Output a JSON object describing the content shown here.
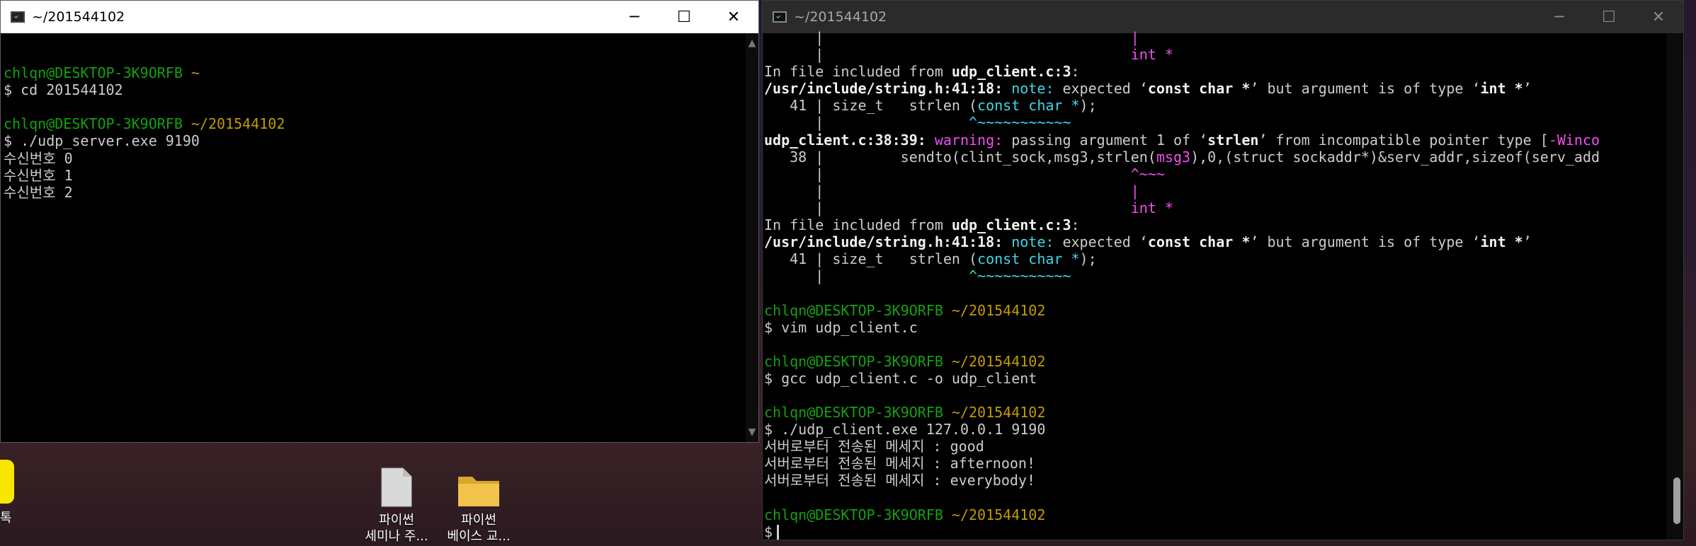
{
  "left_window": {
    "title": "~/201544102",
    "controls": {
      "minimize": "─",
      "maximize": "☐",
      "close": "✕"
    },
    "lines": [
      [
        {
          "t": "",
          "c": ""
        }
      ],
      [
        {
          "t": "chlqn@DESKTOP-3K9ORFB",
          "c": "green"
        },
        {
          "t": " ~",
          "c": "yellow"
        }
      ],
      [
        {
          "t": "$ cd 201544102",
          "c": ""
        }
      ],
      [
        {
          "t": "",
          "c": ""
        }
      ],
      [
        {
          "t": "chlqn@DESKTOP-3K9ORFB",
          "c": "green"
        },
        {
          "t": " ~/201544102",
          "c": "yellow"
        }
      ],
      [
        {
          "t": "$ ./udp_server.exe 9190",
          "c": ""
        }
      ],
      [
        {
          "t": "수신번호 0",
          "c": ""
        }
      ],
      [
        {
          "t": "수신번호 1",
          "c": ""
        }
      ],
      [
        {
          "t": "수신번호 2",
          "c": ""
        }
      ]
    ]
  },
  "right_window": {
    "title": "~/201544102",
    "controls": {
      "minimize": "─",
      "maximize": "☐",
      "close": "✕"
    },
    "lines": [
      [
        {
          "t": "      |                                    ",
          "c": ""
        },
        {
          "t": "|",
          "c": "magenta"
        }
      ],
      [
        {
          "t": "      |                                    ",
          "c": ""
        },
        {
          "t": "int *",
          "c": "magenta"
        }
      ],
      [
        {
          "t": "In file included from ",
          "c": ""
        },
        {
          "t": "udp_client.c:3",
          "c": "bold"
        },
        {
          "t": ":",
          "c": ""
        }
      ],
      [
        {
          "t": "/usr/include/string.h:41:18: ",
          "c": "bold"
        },
        {
          "t": "note: ",
          "c": "cyan"
        },
        {
          "t": "expected ‘",
          "c": ""
        },
        {
          "t": "const char *",
          "c": "bold"
        },
        {
          "t": "’ but argument is of type ‘",
          "c": ""
        },
        {
          "t": "int *",
          "c": "bold"
        },
        {
          "t": "’",
          "c": ""
        }
      ],
      [
        {
          "t": "   41 | size_t   strlen (",
          "c": ""
        },
        {
          "t": "const char *",
          "c": "cyan"
        },
        {
          "t": ");",
          "c": ""
        }
      ],
      [
        {
          "t": "      |                 ",
          "c": ""
        },
        {
          "t": "^~~~~~~~~~~~",
          "c": "cyan"
        }
      ],
      [
        {
          "t": "udp_client.c:38:39: ",
          "c": "bold"
        },
        {
          "t": "warning: ",
          "c": "magenta"
        },
        {
          "t": "passing argument 1 of ‘",
          "c": ""
        },
        {
          "t": "strlen",
          "c": "bold"
        },
        {
          "t": "’ from incompatible pointer type [",
          "c": ""
        },
        {
          "t": "-Winco",
          "c": "magenta"
        }
      ],
      [
        {
          "t": "   38 |         sendto(clint_sock,msg3,strlen(",
          "c": ""
        },
        {
          "t": "msg3",
          "c": "magenta"
        },
        {
          "t": "),0,(struct sockaddr*)&serv_addr,sizeof(serv_add",
          "c": ""
        }
      ],
      [
        {
          "t": "      |                                    ",
          "c": ""
        },
        {
          "t": "^~~~",
          "c": "magenta"
        }
      ],
      [
        {
          "t": "      |                                    ",
          "c": ""
        },
        {
          "t": "|",
          "c": "magenta"
        }
      ],
      [
        {
          "t": "      |                                    ",
          "c": ""
        },
        {
          "t": "int *",
          "c": "magenta"
        }
      ],
      [
        {
          "t": "In file included from ",
          "c": ""
        },
        {
          "t": "udp_client.c:3",
          "c": "bold"
        },
        {
          "t": ":",
          "c": ""
        }
      ],
      [
        {
          "t": "/usr/include/string.h:41:18: ",
          "c": "bold"
        },
        {
          "t": "note: ",
          "c": "cyan"
        },
        {
          "t": "expected ‘",
          "c": ""
        },
        {
          "t": "const char *",
          "c": "bold"
        },
        {
          "t": "’ but argument is of type ‘",
          "c": ""
        },
        {
          "t": "int *",
          "c": "bold"
        },
        {
          "t": "’",
          "c": ""
        }
      ],
      [
        {
          "t": "   41 | size_t   strlen (",
          "c": ""
        },
        {
          "t": "const char *",
          "c": "cyan"
        },
        {
          "t": ");",
          "c": ""
        }
      ],
      [
        {
          "t": "      |                 ",
          "c": ""
        },
        {
          "t": "^~~~~~~~~~~~",
          "c": "cyan"
        }
      ],
      [
        {
          "t": "",
          "c": ""
        }
      ],
      [
        {
          "t": "chlqn@DESKTOP-3K9ORFB",
          "c": "green"
        },
        {
          "t": " ~/201544102",
          "c": "yellow"
        }
      ],
      [
        {
          "t": "$ vim udp_client.c",
          "c": ""
        }
      ],
      [
        {
          "t": "",
          "c": ""
        }
      ],
      [
        {
          "t": "chlqn@DESKTOP-3K9ORFB",
          "c": "green"
        },
        {
          "t": " ~/201544102",
          "c": "yellow"
        }
      ],
      [
        {
          "t": "$ gcc udp_client.c -o udp_client",
          "c": ""
        }
      ],
      [
        {
          "t": "",
          "c": ""
        }
      ],
      [
        {
          "t": "chlqn@DESKTOP-3K9ORFB",
          "c": "green"
        },
        {
          "t": " ~/201544102",
          "c": "yellow"
        }
      ],
      [
        {
          "t": "$ ./udp_client.exe 127.0.0.1 9190",
          "c": ""
        }
      ],
      [
        {
          "t": "서버로부터 전송된 메세지 : good",
          "c": ""
        }
      ],
      [
        {
          "t": "서버로부터 전송된 메세지 : afternoon!",
          "c": ""
        }
      ],
      [
        {
          "t": "서버로부터 전송된 메세지 : everybody!",
          "c": ""
        }
      ],
      [
        {
          "t": "",
          "c": ""
        }
      ],
      [
        {
          "t": "chlqn@DESKTOP-3K9ORFB",
          "c": "green"
        },
        {
          "t": " ~/201544102",
          "c": "yellow"
        }
      ],
      [
        {
          "t": "$",
          "c": ""
        }
      ]
    ]
  },
  "desktop": {
    "kakao_label": "톡",
    "icons": [
      {
        "line1": "파이썬",
        "line2": "세미나 주...",
        "icon": "file-icon"
      },
      {
        "line1": "파이썬",
        "line2": "베이스 교...",
        "icon": "folder-icon"
      }
    ]
  },
  "colors": {
    "prompt_user": "#13a10e",
    "prompt_path": "#c19c00",
    "warning": "#f24ef2",
    "note": "#3fd7e6",
    "terminal_text": "#cccccc"
  }
}
